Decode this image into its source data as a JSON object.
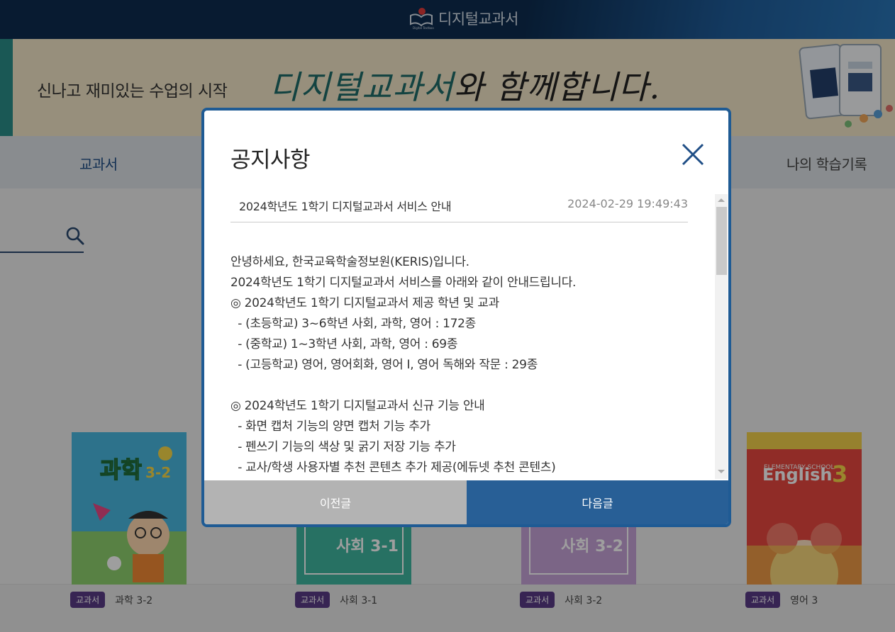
{
  "header": {
    "logo_text": "디지털교과서"
  },
  "banner": {
    "subtitle": "신나고 재미있는 수업의 시작",
    "title_accent": "디지털교과서",
    "title_rest": "와 함께합니다."
  },
  "nav": {
    "left_item": "교과서",
    "right_item": "나의 학습기록"
  },
  "books": [
    {
      "badge": "교과서",
      "title": "과학 3-2"
    },
    {
      "badge": "교과서",
      "title": "사회 3-1"
    },
    {
      "badge": "교과서",
      "title": "사회 3-2"
    },
    {
      "badge": "교과서",
      "title": "영어 3"
    }
  ],
  "modal": {
    "title": "공지사항",
    "notice_title": "2024학년도 1학기 디지털교과서 서비스 안내",
    "notice_date": "2024-02-29 19:49:43",
    "body": "안녕하세요, 한국교육학술정보원(KERIS)입니다.\n2024학년도 1학기 디지털교과서 서비스를 아래와 같이 안내드립니다.\n◎ 2024학년도 1학기 디지털교과서 제공 학년 및 교과\n  - (초등학교) 3~6학년 사회, 과학, 영어 : 172종\n  - (중학교) 1~3학년 사회, 과학, 영어 : 69종\n  - (고등학교) 영어, 영어회화, 영어 I, 영어 독해와 작문 : 29종\n\n◎ 2024학년도 1학기 디지털교과서 신규 기능 안내\n  - 화면 캡처 기능의 양면 캡처 기능 추가\n  - 펜쓰기 기능의 색상 및 굵기 저장 기능 추가\n  - 교사/학생 사용자별 추천 콘텐츠 추가 제공(에듀넷 추천 콘텐츠)",
    "prev_label": "이전글",
    "next_label": "다음글"
  },
  "colors": {
    "header_bg": "#0d2c4f",
    "accent_blue": "#285f96",
    "badge_purple": "#5a3b87",
    "banner_bg": "#f4e7c8"
  }
}
